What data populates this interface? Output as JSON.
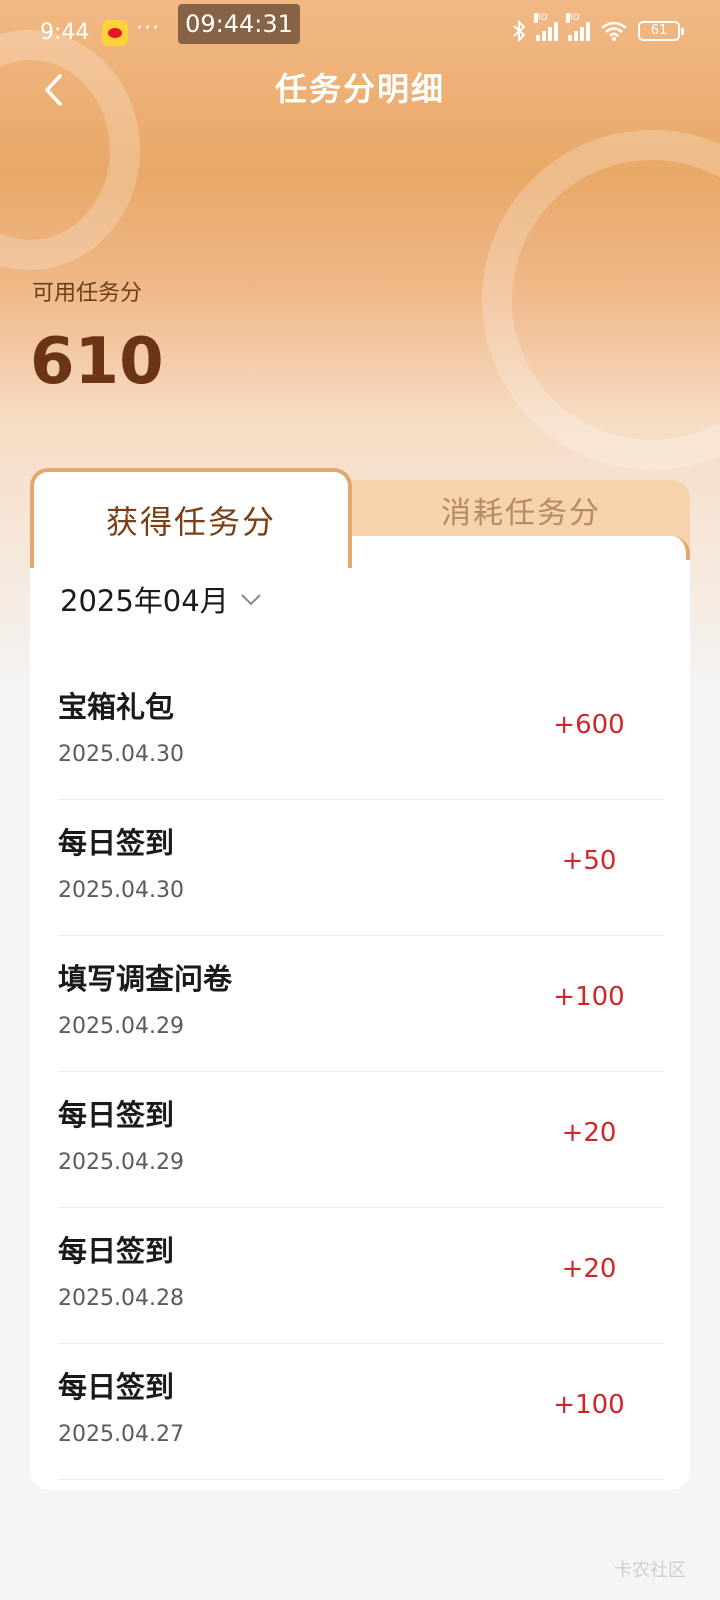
{
  "status_bar": {
    "time": "9:44",
    "more": "···",
    "clock_overlay": "09:44:31",
    "battery": "61",
    "hd_label": "HD"
  },
  "header": {
    "title": "任务分明细"
  },
  "summary": {
    "label": "可用任务分",
    "value": "610"
  },
  "tabs": [
    {
      "label": "获得任务分",
      "active": true
    },
    {
      "label": "消耗任务分",
      "active": false
    }
  ],
  "filter": {
    "month": "2025年04月"
  },
  "records": [
    {
      "title": "宝箱礼包",
      "date": "2025.04.30",
      "amount": "+600"
    },
    {
      "title": "每日签到",
      "date": "2025.04.30",
      "amount": "+50"
    },
    {
      "title": "填写调查问卷",
      "date": "2025.04.29",
      "amount": "+100"
    },
    {
      "title": "每日签到",
      "date": "2025.04.29",
      "amount": "+20"
    },
    {
      "title": "每日签到",
      "date": "2025.04.28",
      "amount": "+20"
    },
    {
      "title": "每日签到",
      "date": "2025.04.27",
      "amount": "+100"
    }
  ],
  "watermark": "卡农社区",
  "colors": {
    "accent": "#e3a86e",
    "amount": "#d0262a",
    "title_dark": "#6b3416"
  }
}
